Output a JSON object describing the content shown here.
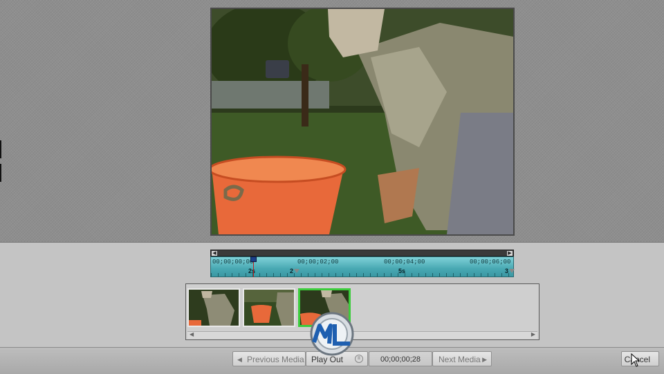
{
  "timeline": {
    "timecodes": [
      "00;00;00;00",
      "00;00;02;00",
      "00;00;04;00",
      "00;00;06;00"
    ],
    "major_labels": [
      "2s",
      "5s"
    ],
    "marker_numbers": [
      "2",
      "3"
    ]
  },
  "clips": [
    {
      "id": "clip-1",
      "selected": false
    },
    {
      "id": "clip-2",
      "selected": false
    },
    {
      "id": "clip-3",
      "selected": true
    }
  ],
  "controls": {
    "prev_media_label": "Previous Media",
    "playout_label": "Play Out",
    "timecode": "00;00;00;28",
    "next_media_label": "Next Media",
    "cancel_label": "Cancel"
  },
  "icons": {
    "prev": "chevron-left-icon",
    "next": "chevron-right-icon",
    "pause": "pause-icon",
    "cursor": "mouse-cursor-icon"
  },
  "colors": {
    "timeline_accent": "#48a8b2",
    "selected_clip_border": "#3ccc3c",
    "playhead_line": "#c02020"
  }
}
